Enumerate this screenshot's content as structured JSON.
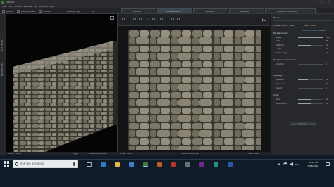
{
  "app": {
    "title": "PixPlant"
  },
  "menu": [
    "File",
    "Edit",
    "Choose",
    "2D Map",
    "3D",
    "Window",
    "Help"
  ],
  "toolbar": {
    "offset_label": "Offset",
    "displacement_label": "Displacement",
    "normal_label": "Normal",
    "quality_label": "Quality: High"
  },
  "map_tabs": [
    "Diffuse",
    "Displacement",
    "Normal",
    "Specular",
    "Ambient Occlusion"
  ],
  "sidebar_tabs": [
    "MATERIAL",
    "SEAMLESS"
  ],
  "view2d": {
    "size_readout": "2048 x 2048 px",
    "filter_label": "Filter: Both",
    "tile_label": "View Tiled"
  },
  "view3d": {
    "model_label": "Model: Plane",
    "light_label": "Light",
    "lighting_label": "Lighting: Simple"
  },
  "props": {
    "header": "Bitmap",
    "tabs": [
      "Displacement Tools",
      "Paint Tools"
    ],
    "preset_link": "Smooth Mixed Details",
    "sections": [
      {
        "title": "Displacement",
        "rows": [
          "Scale",
          "Slots",
          "Medium",
          "Large",
          "Extra Large"
        ]
      },
      {
        "title": "Displacement Presets",
        "rows": [
          "Smooth"
        ]
      },
      {
        "title": "Shading",
        "rows": [
          "Shadow",
          "Occlusion",
          "Depth"
        ]
      },
      {
        "title": "Color",
        "rows": [
          "Hue",
          "Saturation"
        ]
      }
    ],
    "values": [
      100,
      75,
      50,
      60,
      50,
      0,
      40,
      40,
      0,
      50,
      50
    ],
    "reset_label": "Reset"
  },
  "taskbar": {
    "search_placeholder": "Ask me anything",
    "time": "10:01 AM",
    "date": "8/16/2016",
    "lang": "ENG"
  },
  "colors": {
    "accent_tab": "#2c2f34",
    "taskbar": "#101b28",
    "panel": "#26282b"
  }
}
